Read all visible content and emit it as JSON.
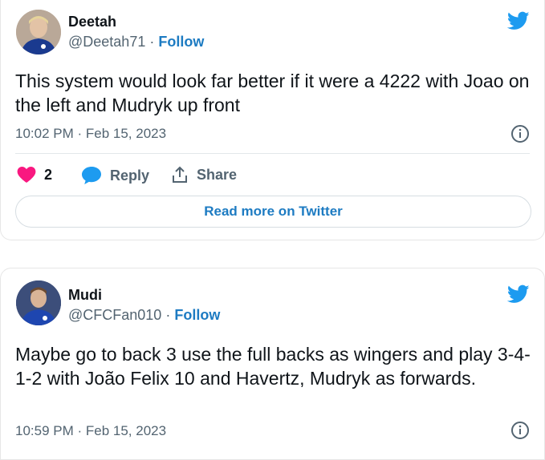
{
  "tweets": [
    {
      "name": "Deetah",
      "handle": "@Deetah71",
      "separator": "·",
      "follow_label": "Follow",
      "text": "This system would look far better if it were a 4222 with Joao on the left and Mudryk up front",
      "timestamp": "10:02 PM · Feb 15, 2023",
      "likes": "2",
      "reply_label": "Reply",
      "share_label": "Share",
      "read_more_label": "Read more on Twitter"
    },
    {
      "name": "Mudi",
      "handle": "@CFCFan010",
      "separator": "·",
      "follow_label": "Follow",
      "text": "Maybe go to back 3 use the full backs as wingers and play 3-4-1-2 with João Felix 10 and Havertz, Mudryk as forwards.",
      "timestamp": "10:59 PM · Feb 15, 2023"
    }
  ],
  "colors": {
    "twitter_blue": "#1d9bf0",
    "follow_blue": "#1d7bc2",
    "like_pink": "#f91880",
    "muted_text": "#536471"
  },
  "icons": [
    "twitter-bird-icon",
    "info-icon",
    "heart-icon",
    "reply-bubble-icon",
    "share-icon"
  ]
}
